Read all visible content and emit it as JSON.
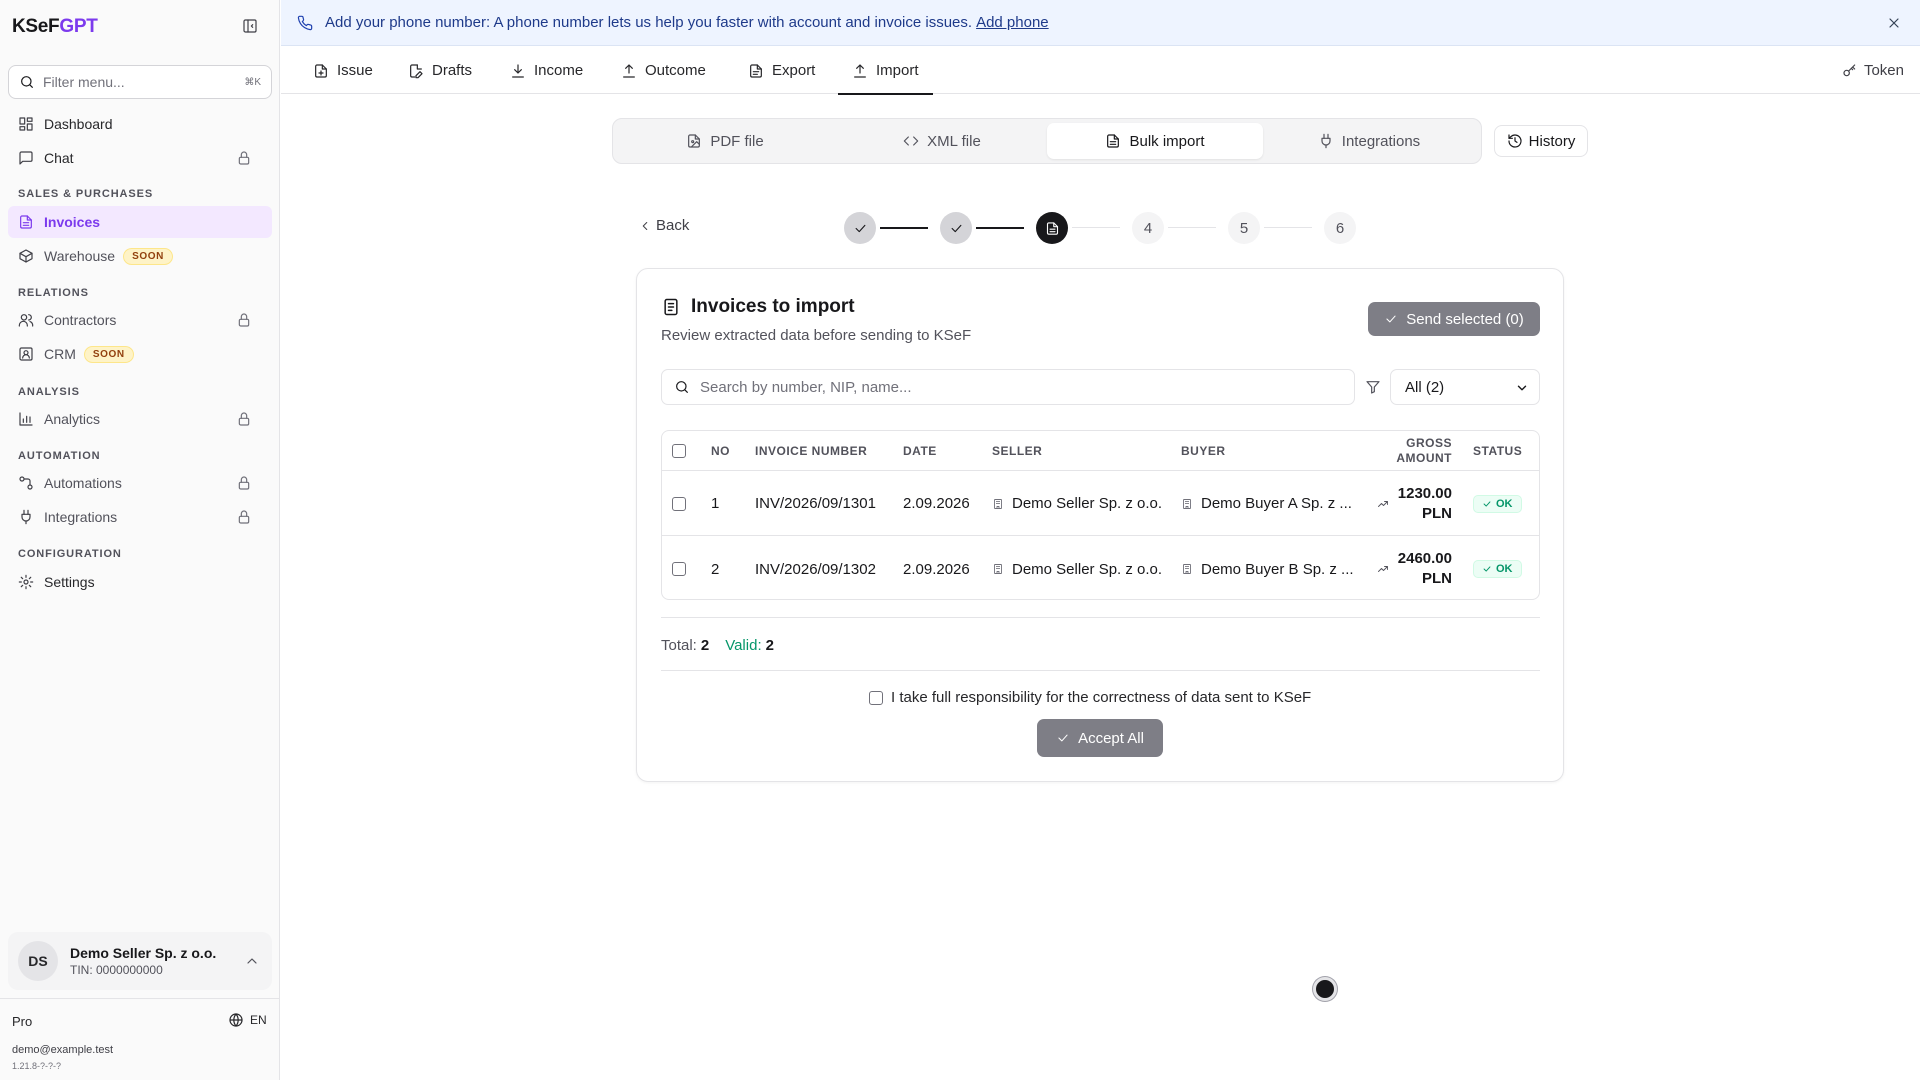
{
  "sidebar": {
    "brand_main": "KSeF",
    "brand_accent": "GPT",
    "filter_placeholder": "Filter menu...",
    "filter_shortcut": "⌘K",
    "items": {
      "dashboard": "Dashboard",
      "chat": "Chat",
      "invoices": "Invoices",
      "warehouse": "Warehouse",
      "contractors": "Contractors",
      "crm": "CRM",
      "analytics": "Analytics",
      "automations": "Automations",
      "integrations": "Integrations",
      "settings": "Settings"
    },
    "badge_soon": "SOON",
    "sections": {
      "sales": "SALES & PURCHASES",
      "relations": "RELATIONS",
      "analysis": "ANALYSIS",
      "automation": "AUTOMATION",
      "configuration": "CONFIGURATION"
    },
    "org": {
      "initials": "DS",
      "name": "Demo Seller Sp. z o.o.",
      "tin": "TIN: 0000000000"
    },
    "plan": "Pro",
    "language": "EN",
    "email": "demo@example.test",
    "version": "1.21.8-?-?-?"
  },
  "banner": {
    "text": "Add your phone number: A phone number lets us help you faster with account and invoice issues.",
    "link": "Add phone"
  },
  "topnav": {
    "tabs": [
      "Issue",
      "Drafts",
      "Income",
      "Outcome",
      "Export",
      "Import"
    ],
    "active": "Import",
    "token": "Token"
  },
  "import_tabs": {
    "tabs": [
      "PDF file",
      "XML file",
      "Bulk import",
      "Integrations"
    ],
    "active": "Bulk import",
    "history": "History"
  },
  "stepper": {
    "back": "Back",
    "steps": [
      "",
      "",
      "",
      "4",
      "5",
      "6"
    ],
    "current_step": 3
  },
  "card": {
    "title": "Invoices to import",
    "subtitle": "Review extracted data before sending to KSeF",
    "send_button": "Send selected (0)",
    "search_placeholder": "Search by number, NIP, name...",
    "filter_value": "All (2)",
    "columns": {
      "no": "NO",
      "invoice_number": "INVOICE NUMBER",
      "date": "DATE",
      "seller": "SELLER",
      "buyer": "BUYER",
      "gross_amount_1": "GROSS",
      "gross_amount_2": "AMOUNT",
      "status": "STATUS"
    },
    "rows": [
      {
        "no": "1",
        "invoice_number": "INV/2026/09/1301",
        "date": "2.09.2026",
        "seller": "Demo Seller Sp. z o.o.",
        "buyer": "Demo Buyer A Sp. z ...",
        "amount": "1230.00",
        "currency": "PLN",
        "status": "OK"
      },
      {
        "no": "2",
        "invoice_number": "INV/2026/09/1302",
        "date": "2.09.2026",
        "seller": "Demo Seller Sp. z o.o.",
        "buyer": "Demo Buyer B Sp. z ...",
        "amount": "2460.00",
        "currency": "PLN",
        "status": "OK"
      }
    ],
    "totals": {
      "total_label": "Total:",
      "total_value": "2",
      "valid_label": "Valid:",
      "valid_value": "2"
    },
    "responsibility": "I take full responsibility for the correctness of data sent to KSeF",
    "accept_button": "Accept All"
  },
  "colors": {
    "accent": "#7c3aed",
    "ok": "#059669",
    "banner_bg": "#eef4ff"
  }
}
